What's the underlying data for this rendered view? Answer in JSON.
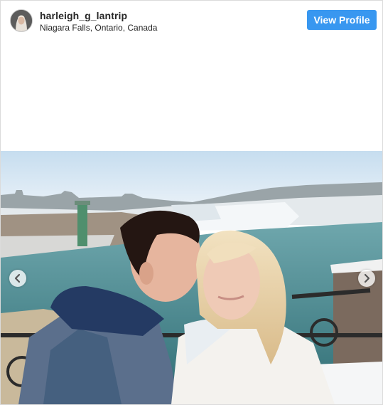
{
  "header": {
    "username": "harleigh_g_lantrip",
    "location": "Niagara Falls, Ontario, Canada",
    "view_profile_label": "View Profile"
  },
  "icons": {
    "avatar": "avatar",
    "prev": "chevron-left-icon",
    "next": "chevron-right-icon"
  },
  "colors": {
    "button": "#3897f0",
    "text": "#262626",
    "border": "#dbdbdb"
  }
}
